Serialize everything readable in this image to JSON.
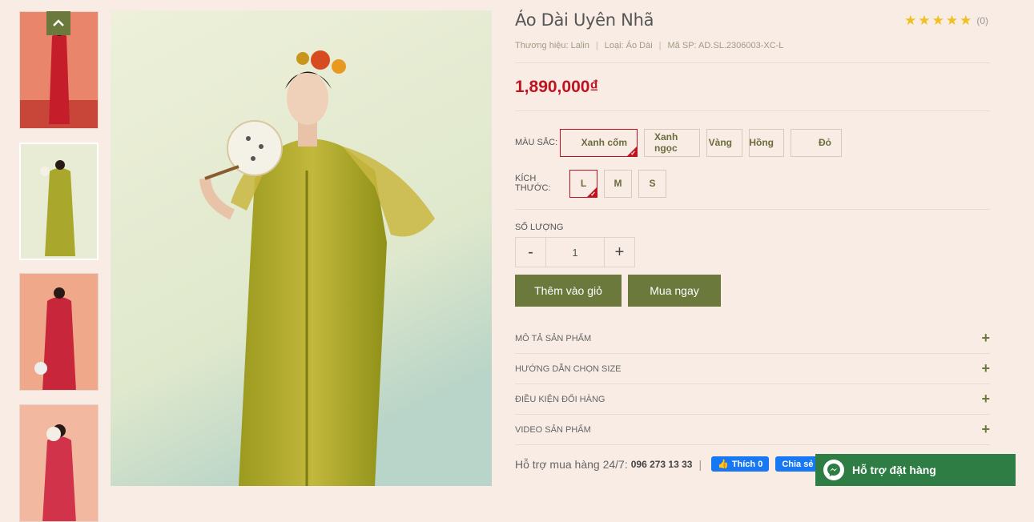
{
  "product": {
    "title": "Áo Dài Uyên Nhã",
    "rating_count": "(0)",
    "brand": "Thương hiệu: Lalin",
    "category": "Loại: Áo Dài",
    "sku": "Mã SP: AD.SL.2306003-XC-L",
    "price": "1,890,000₫"
  },
  "options": {
    "color_label": "MÀU SẮC:",
    "colors": [
      "Xanh cốm",
      "Xanh ngọc",
      "Vàng",
      "Hồng",
      "Đỏ"
    ],
    "selected_color": "Xanh cốm",
    "size_label": "KÍCH THƯỚC:",
    "sizes": [
      "L",
      "M",
      "S"
    ],
    "selected_size": "L"
  },
  "quantity": {
    "label": "SỐ LƯỢNG",
    "minus": "-",
    "value": "1",
    "plus": "+"
  },
  "actions": {
    "add_to_cart": "Thêm vào giỏ",
    "buy_now": "Mua ngay"
  },
  "accordion": [
    "MÔ TẢ SẢN PHẨM",
    "HƯỚNG DẪN CHỌN SIZE",
    "ĐIỀU KIỆN ĐỔI HÀNG",
    "VIDEO SẢN PHẨM"
  ],
  "support": {
    "label": "Hỗ trợ mua hàng 24/7:",
    "phone": "096 273 13 33",
    "like": "Thích 0",
    "share": "Chia sẻ"
  },
  "chat": {
    "label": "Hỗ trợ đặt hàng"
  },
  "colors": {
    "accent": "#6b7a3c",
    "price": "#c0131f",
    "chat": "#2e7d44",
    "background": "#f8ece5"
  }
}
